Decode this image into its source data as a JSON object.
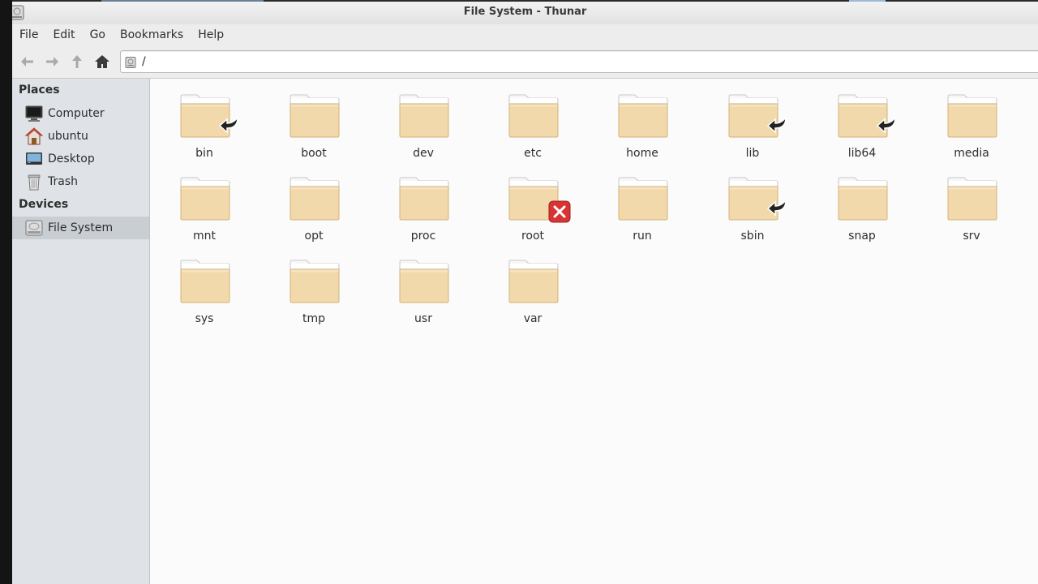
{
  "window": {
    "title": "File System - Thunar",
    "icon": "drive-harddisk-icon"
  },
  "menu": [
    "File",
    "Edit",
    "Go",
    "Bookmarks",
    "Help"
  ],
  "toolbar": {
    "back_icon": "arrow-left-icon",
    "forward_icon": "arrow-right-icon",
    "up_icon": "arrow-up-icon",
    "home_icon": "home-icon",
    "location_path": "/"
  },
  "sidebar": {
    "places_header": "Places",
    "places": [
      {
        "label": "Computer",
        "icon": "computer-icon"
      },
      {
        "label": "ubuntu",
        "icon": "user-home-icon"
      },
      {
        "label": "Desktop",
        "icon": "desktop-icon"
      },
      {
        "label": "Trash",
        "icon": "trash-icon"
      }
    ],
    "devices_header": "Devices",
    "devices": [
      {
        "label": "File System",
        "icon": "drive-harddisk-icon",
        "selected": true
      }
    ]
  },
  "files": [
    {
      "name": "bin",
      "emblem": "symlink"
    },
    {
      "name": "boot",
      "emblem": ""
    },
    {
      "name": "dev",
      "emblem": ""
    },
    {
      "name": "etc",
      "emblem": ""
    },
    {
      "name": "home",
      "emblem": ""
    },
    {
      "name": "lib",
      "emblem": "symlink"
    },
    {
      "name": "lib64",
      "emblem": "symlink"
    },
    {
      "name": "media",
      "emblem": ""
    },
    {
      "name": "mnt",
      "emblem": ""
    },
    {
      "name": "opt",
      "emblem": ""
    },
    {
      "name": "proc",
      "emblem": ""
    },
    {
      "name": "root",
      "emblem": "unreadable"
    },
    {
      "name": "run",
      "emblem": ""
    },
    {
      "name": "sbin",
      "emblem": "symlink"
    },
    {
      "name": "snap",
      "emblem": ""
    },
    {
      "name": "srv",
      "emblem": ""
    },
    {
      "name": "sys",
      "emblem": ""
    },
    {
      "name": "tmp",
      "emblem": ""
    },
    {
      "name": "usr",
      "emblem": ""
    },
    {
      "name": "var",
      "emblem": ""
    }
  ],
  "colors": {
    "folder_body": "#f2d9ab",
    "folder_tab": "#f7f7f7",
    "unreadable_emblem": "#d83434",
    "sidebar_bg": "#dfe3e7"
  }
}
